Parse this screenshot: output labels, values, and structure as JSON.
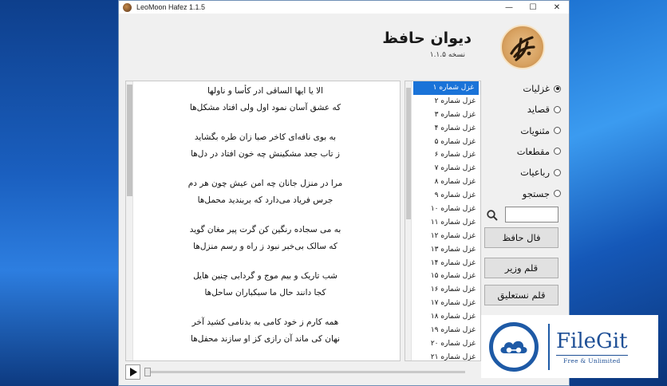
{
  "window": {
    "title": "LeoMoon Hafez 1.1.5",
    "minimize_glyph": "—",
    "maximize_glyph": "☐",
    "close_glyph": "✕"
  },
  "header": {
    "app_title": "دیوان حافظ",
    "version": "نسخه ۱.۱.۵",
    "logo_icon": "hafez-calligraphy-logo"
  },
  "poem": {
    "couplets": [
      [
        "الا یا ایها الساقی ادر کأسا و ناولها",
        "که عشق آسان نمود اول ولی افتاد مشکل‌ها"
      ],
      [
        "به بوی نافه‌ای کاخر صبا زان طره بگشاید",
        "ز تاب جعد مشکینش چه خون افتاد در دل‌ها"
      ],
      [
        "مرا در منزل جانان چه امن عیش چون هر دم",
        "جرس فریاد می‌دارد که بربندید محمل‌ها"
      ],
      [
        "به می سجاده رنگین کن گرت پیر مغان گوید",
        "که سالک بی‌خبر نبود ز راه و رسم منزل‌ها"
      ],
      [
        "شب تاریک و بیم موج و گردابی چنین هایل",
        "کجا دانند حال ما سبکباران ساحل‌ها"
      ],
      [
        "همه کارم ز خود کامی به بدنامی کشید آخر",
        "نهان کی ماند آن رازی کز او سازند محفل‌ها"
      ]
    ]
  },
  "list": {
    "items": [
      "غزل شماره ۱",
      "غزل شماره ۲",
      "غزل شماره ۳",
      "غزل شماره ۴",
      "غزل شماره ۵",
      "غزل شماره ۶",
      "غزل شماره ۷",
      "غزل شماره ۸",
      "غزل شماره ۹",
      "غزل شماره ۱۰",
      "غزل شماره ۱۱",
      "غزل شماره ۱۲",
      "غزل شماره ۱۳",
      "غزل شماره ۱۴",
      "غزل شماره ۱۵",
      "غزل شماره ۱۶",
      "غزل شماره ۱۷",
      "غزل شماره ۱۸",
      "غزل شماره ۱۹",
      "غزل شماره ۲۰",
      "غزل شماره ۲۱"
    ],
    "selected_index": 0
  },
  "sidebar": {
    "categories": [
      "غزلیات",
      "قصاید",
      "مثنویات",
      "مقطعات",
      "رباعیات",
      "جستجو"
    ],
    "selected_category": 0,
    "search_value": "",
    "search_icon": "magnifier-icon",
    "buttons": {
      "fal": "فال حافظ",
      "font_vazir": "قلم وزیر",
      "font_nastaliq": "قلم نستعلیق"
    }
  },
  "player": {
    "play_icon": "play-icon",
    "progress": 0
  },
  "watermark": {
    "name": "FileGit",
    "tagline": "Free & Unlimited"
  },
  "colors": {
    "selection": "#1a73d8",
    "brand_blue": "#1e5aa6",
    "logo_gold": "#d8a261"
  }
}
